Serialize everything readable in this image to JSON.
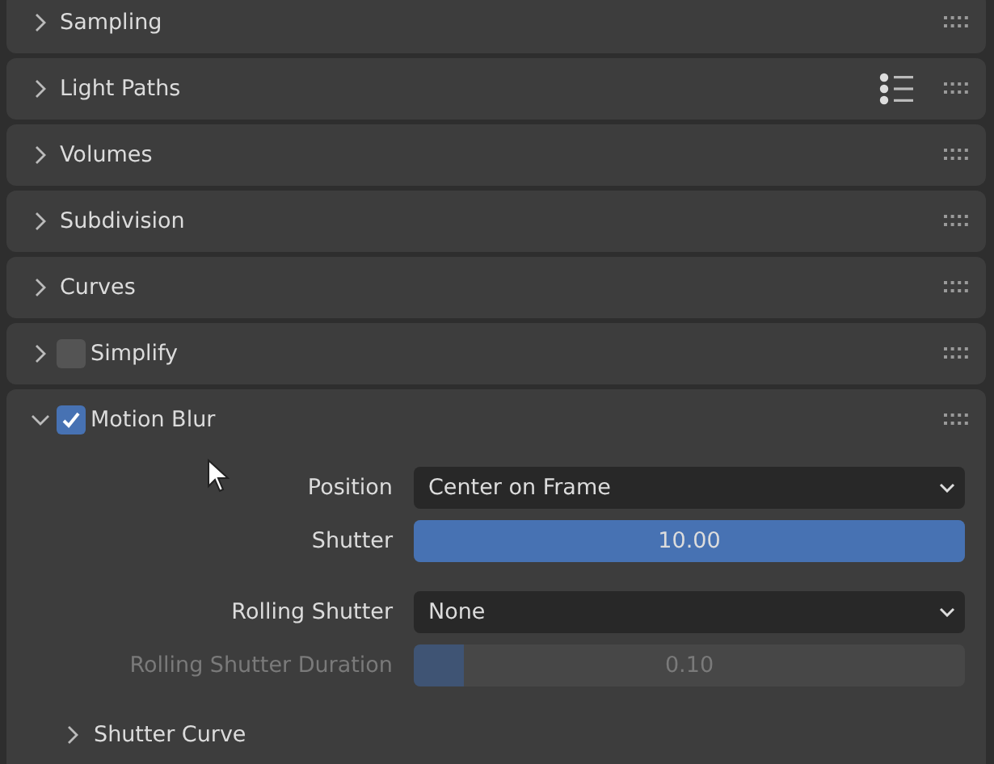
{
  "panels": [
    {
      "title": "Sampling",
      "kind": "plain",
      "expanded": false,
      "presets_menu": false
    },
    {
      "title": "Light Paths",
      "kind": "plain",
      "expanded": false,
      "presets_menu": true
    },
    {
      "title": "Volumes",
      "kind": "plain",
      "expanded": false,
      "presets_menu": false
    },
    {
      "title": "Subdivision",
      "kind": "plain",
      "expanded": false,
      "presets_menu": false
    },
    {
      "title": "Curves",
      "kind": "plain",
      "expanded": false,
      "presets_menu": false
    },
    {
      "title": "Simplify",
      "kind": "toggle",
      "checked": false,
      "expanded": false,
      "presets_menu": false
    },
    {
      "title": "Motion Blur",
      "kind": "toggle",
      "checked": true,
      "expanded": true,
      "presets_menu": false,
      "property_groups": [
        [
          {
            "label": "Position",
            "kind": "dropdown",
            "value": "Center on Frame",
            "disabled": false
          },
          {
            "label": "Shutter",
            "kind": "slider",
            "value": "10.00",
            "level": 1,
            "disabled": false
          }
        ],
        [
          {
            "label": "Rolling Shutter",
            "kind": "dropdown",
            "value": "None",
            "disabled": false
          },
          {
            "label": "Rolling Shutter Duration",
            "kind": "slider",
            "value": "0.10",
            "level": 0.09,
            "disabled": true
          }
        ]
      ],
      "subpanels": [
        {
          "title": "Shutter Curve",
          "expanded": false
        }
      ]
    }
  ]
}
